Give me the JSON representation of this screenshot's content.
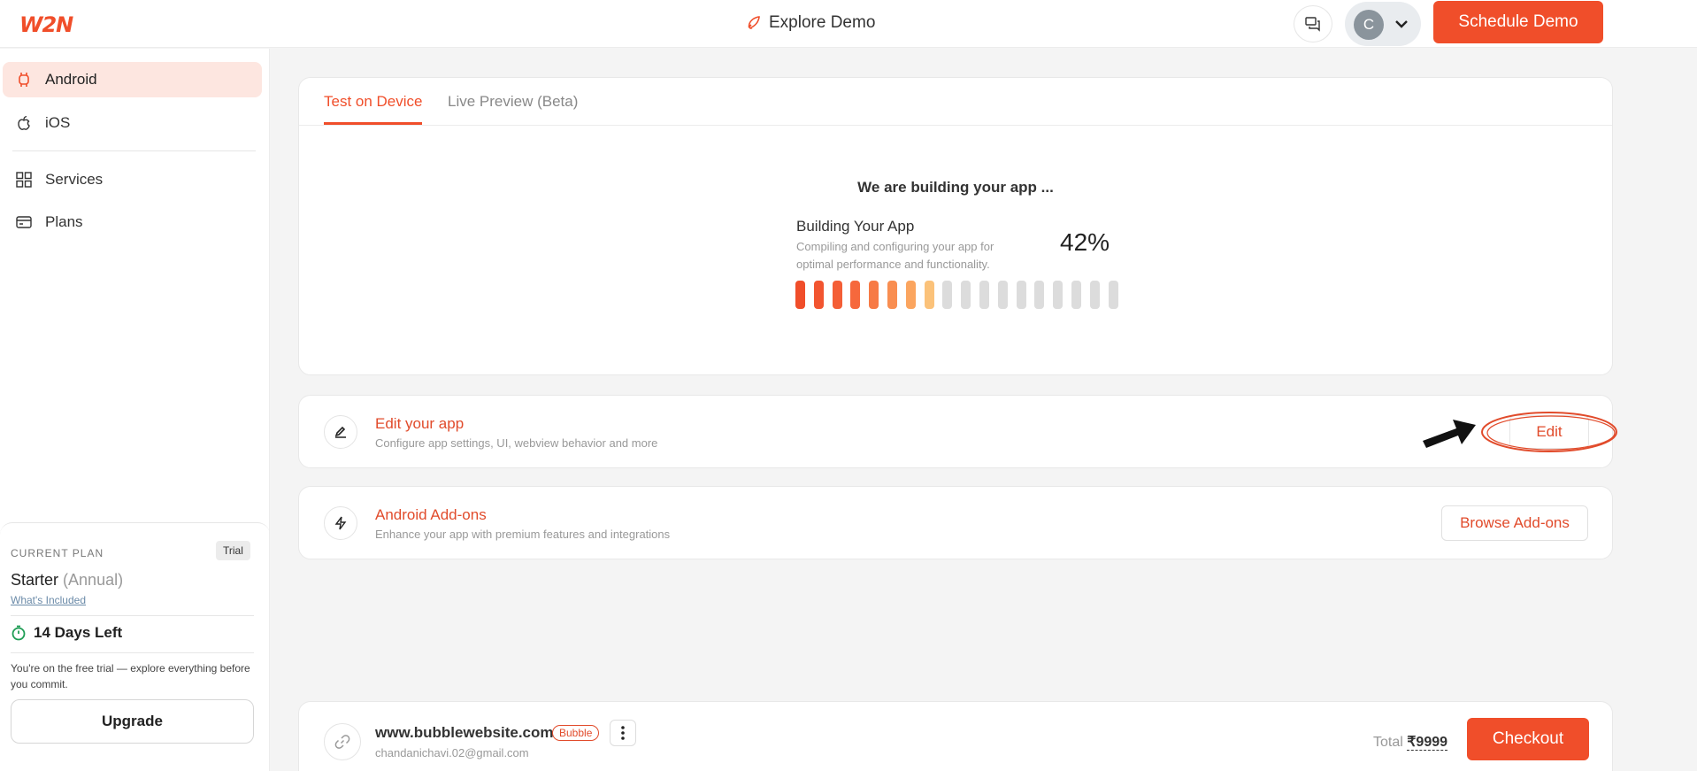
{
  "header": {
    "logo": "W2N",
    "title": "Explore Demo",
    "avatar_letter": "C",
    "schedule_label": "Schedule Demo"
  },
  "sidebar": {
    "items": [
      {
        "label": "Android",
        "icon": "android-icon",
        "active": true
      },
      {
        "label": "iOS",
        "icon": "apple-icon",
        "active": false
      },
      {
        "label": "Services",
        "icon": "grid-icon",
        "active": false
      },
      {
        "label": "Plans",
        "icon": "card-icon",
        "active": false
      }
    ],
    "plan": {
      "label": "CURRENT PLAN",
      "badge": "Trial",
      "name": "Starter",
      "period": "(Annual)",
      "whats_included": "What's Included",
      "days_left": "14 Days Left",
      "note": "You're on the free trial — explore everything before you commit.",
      "upgrade_label": "Upgrade"
    }
  },
  "build": {
    "tabs": [
      {
        "label": "Test on Device",
        "active": true
      },
      {
        "label": "Live Preview (Beta)",
        "active": false
      }
    ],
    "heading": "We are building your app ...",
    "title": "Building Your App",
    "description": "Compiling and configuring your app for optimal performance and functionality.",
    "percent_text": "42%",
    "progress": 0.42,
    "segments_total": 18,
    "segments_filled": 8,
    "segment_colors": [
      "#f04e2a",
      "#f25530",
      "#f45e36",
      "#f6683c",
      "#f77a45",
      "#f98e51",
      "#fba55f",
      "#fbc27a"
    ]
  },
  "edit_card": {
    "title": "Edit your app",
    "subtitle": "Configure app settings, UI, webview behavior and more",
    "button": "Edit"
  },
  "addon_card": {
    "title": "Android Add-ons",
    "subtitle": "Enhance your app with premium features and integrations",
    "button": "Browse Add-ons"
  },
  "checkout": {
    "url": "www.bubblewebsite.com",
    "badge": "Bubble",
    "email": "chandanichavi.02@gmail.com",
    "total_label": "Total",
    "total_amount": "₹9999",
    "button": "Checkout"
  },
  "colors": {
    "accent": "#f04e2a",
    "active_nav_bg": "#fde6e0",
    "timer_green": "#1f9d55"
  }
}
